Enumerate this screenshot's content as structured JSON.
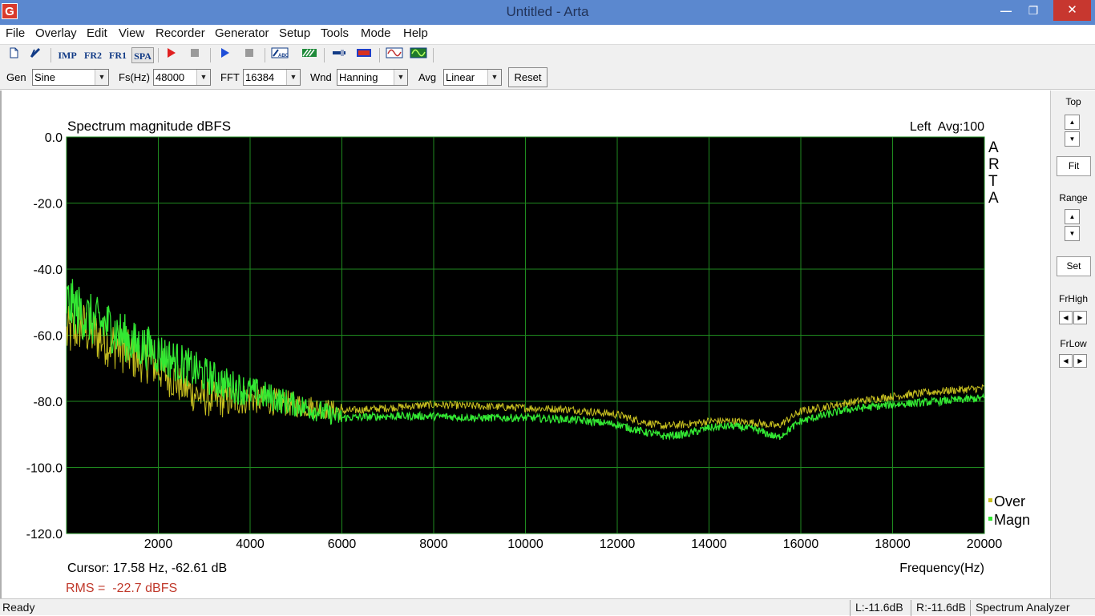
{
  "window": {
    "title": "Untitled - Arta",
    "app_icon_letter": "G",
    "minimize_glyph": "—",
    "maximize_glyph": "❐",
    "close_glyph": "✕"
  },
  "menu": [
    "File",
    "Overlay",
    "Edit",
    "View",
    "Recorder",
    "Generator",
    "Setup",
    "Tools",
    "Mode",
    "Help"
  ],
  "toolbar": {
    "imp": "IMP",
    "fr2": "FR2",
    "fr1": "FR1",
    "spa": "SPA"
  },
  "controls": {
    "gen": {
      "label": "Gen",
      "value": "Sine"
    },
    "fs": {
      "label": "Fs(Hz)",
      "value": "48000"
    },
    "fft": {
      "label": "FFT",
      "value": "16384"
    },
    "wnd": {
      "label": "Wnd",
      "value": "Hanning"
    },
    "avg": {
      "label": "Avg",
      "value": "Linear"
    },
    "reset": "Reset"
  },
  "plot": {
    "cursor_text": "Cursor: 17.58 Hz, -62.61 dB",
    "rms_text": "RMS =  -22.7 dBFS",
    "rms_color": "#c0392b",
    "watermark": [
      "A",
      "R",
      "T",
      "A"
    ]
  },
  "chart_data": {
    "type": "line",
    "title": "Spectrum magnitude dBFS",
    "subtitle": "Left  Avg:100",
    "xlabel": "Frequency(Hz)",
    "ylabel": "",
    "xlim": [
      0,
      20000
    ],
    "ylim": [
      -120,
      0
    ],
    "x_ticks": [
      "2000",
      "4000",
      "6000",
      "8000",
      "10000",
      "12000",
      "14000",
      "16000",
      "18000",
      "20000"
    ],
    "y_ticks": [
      "0.0",
      "-20.0",
      "-40.0",
      "-60.0",
      "-80.0",
      "-100.0",
      "-120.0"
    ],
    "grid": true,
    "legend_placement": "bottom-right",
    "background": "#000000",
    "grid_color": "#1f8a1f",
    "series": [
      {
        "name": "Over",
        "color": "#c8c020",
        "x": [
          0,
          300,
          600,
          900,
          1200,
          1500,
          1800,
          2100,
          2400,
          2700,
          3000,
          3500,
          4000,
          4500,
          5000,
          5500,
          6000,
          7000,
          8000,
          9000,
          10000,
          11000,
          12000,
          12500,
          13000,
          13500,
          14000,
          14500,
          15000,
          15500,
          16000,
          17000,
          18000,
          19000,
          20000
        ],
        "values": [
          -60,
          -57,
          -60,
          -62,
          -64,
          -67,
          -68,
          -71,
          -74,
          -77,
          -79,
          -80,
          -79,
          -80,
          -81,
          -82,
          -83,
          -82,
          -81,
          -81.5,
          -82,
          -82.5,
          -84,
          -86,
          -87.5,
          -87,
          -86,
          -86,
          -86.5,
          -87.5,
          -83,
          -80.5,
          -78.5,
          -77,
          -76
        ]
      },
      {
        "name": "Magn",
        "color": "#33e833",
        "x": [
          0,
          300,
          600,
          900,
          1200,
          1500,
          1800,
          2100,
          2400,
          2700,
          3000,
          3500,
          4000,
          4500,
          5000,
          5500,
          6000,
          7000,
          8000,
          9000,
          10000,
          11000,
          12000,
          12500,
          13000,
          13500,
          14000,
          14500,
          15000,
          15500,
          16000,
          17000,
          18000,
          19000,
          20000
        ],
        "values": [
          -50,
          -53,
          -56,
          -57,
          -60,
          -63,
          -64,
          -66,
          -68,
          -70,
          -72,
          -75,
          -77,
          -79,
          -81,
          -83,
          -85,
          -84.5,
          -84.5,
          -85,
          -85,
          -85.5,
          -87,
          -89,
          -90.5,
          -90,
          -88,
          -87.5,
          -88.5,
          -91,
          -86,
          -82.5,
          -81,
          -80,
          -79
        ]
      }
    ]
  },
  "right_panel": {
    "top": "Top",
    "fit": "Fit",
    "range": "Range",
    "set": "Set",
    "frhigh": "FrHigh",
    "frlow": "FrLow"
  },
  "status": {
    "ready": "Ready",
    "left_level": "L:-11.6dB",
    "right_level": "R:-11.6dB",
    "mode": "Spectrum Analyzer"
  }
}
